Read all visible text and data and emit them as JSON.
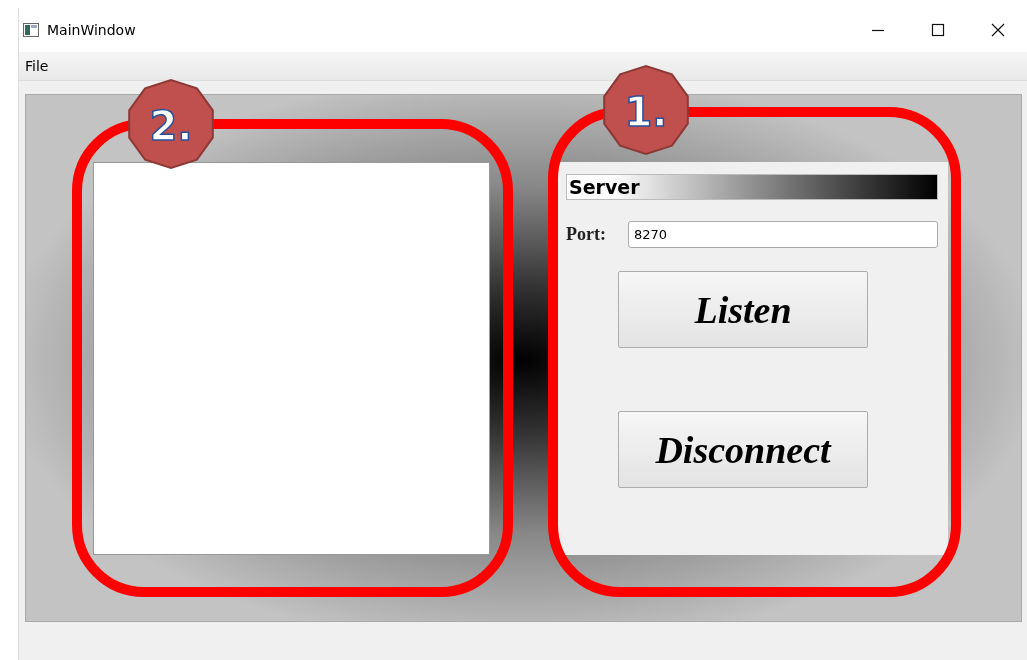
{
  "window": {
    "title": "MainWindow"
  },
  "menu": [
    {
      "label": "File"
    }
  ],
  "annotations": [
    {
      "label": "2."
    },
    {
      "label": "1."
    }
  ],
  "server": {
    "heading": "Server",
    "port_label": "Port:",
    "port_value": "8270",
    "buttons": [
      {
        "label": "Listen"
      },
      {
        "label": "Disconnect"
      }
    ]
  }
}
